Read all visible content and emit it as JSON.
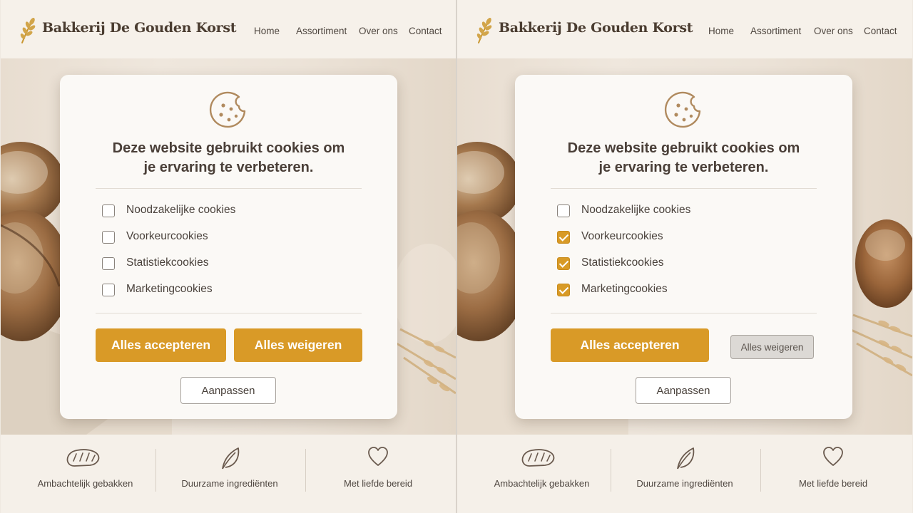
{
  "brand": {
    "name": "Bakkerij De Gouden Korst"
  },
  "nav": [
    "Home",
    "Assortiment",
    "Over ons",
    "Contact"
  ],
  "colors": {
    "accent": "#d99a27",
    "background": "#f6f1ea",
    "text": "#4a3f37"
  },
  "panels": {
    "left": {
      "modal": {
        "icon": "cookie-icon",
        "title_line1": "Deze website gebruikt cookies om",
        "title_line2": "je ervaring te verbeteren.",
        "options": [
          {
            "label": "Noodzakelijke cookies",
            "checked": false
          },
          {
            "label": "Voorkeurcookies",
            "checked": false
          },
          {
            "label": "Statistiekcookies",
            "checked": false
          },
          {
            "label": "Marketingcookies",
            "checked": false
          }
        ],
        "accept_label": "Alles accepteren",
        "reject_label": "Alles weigeren",
        "customize_label": "Aanpassen"
      }
    },
    "right": {
      "modal": {
        "icon": "cookie-icon",
        "title_line1": "Deze website gebruikt cookies om",
        "title_line2": "je ervaring te verbeteren.",
        "options": [
          {
            "label": "Noodzakelijke cookies",
            "checked": false
          },
          {
            "label": "Voorkeurcookies",
            "checked": true
          },
          {
            "label": "Statistiekcookies",
            "checked": true
          },
          {
            "label": "Marketingcookies",
            "checked": true
          }
        ],
        "accept_label": "Alles accepteren",
        "reject_label": "Alles weigeren",
        "customize_label": "Aanpassen"
      }
    }
  },
  "features": [
    {
      "icon": "bread-icon",
      "label": "Ambachtelijk gebakken"
    },
    {
      "icon": "leaf-icon",
      "label": "Duurzame ingrediënten"
    },
    {
      "icon": "heart-icon",
      "label": "Met liefde bereid"
    }
  ]
}
